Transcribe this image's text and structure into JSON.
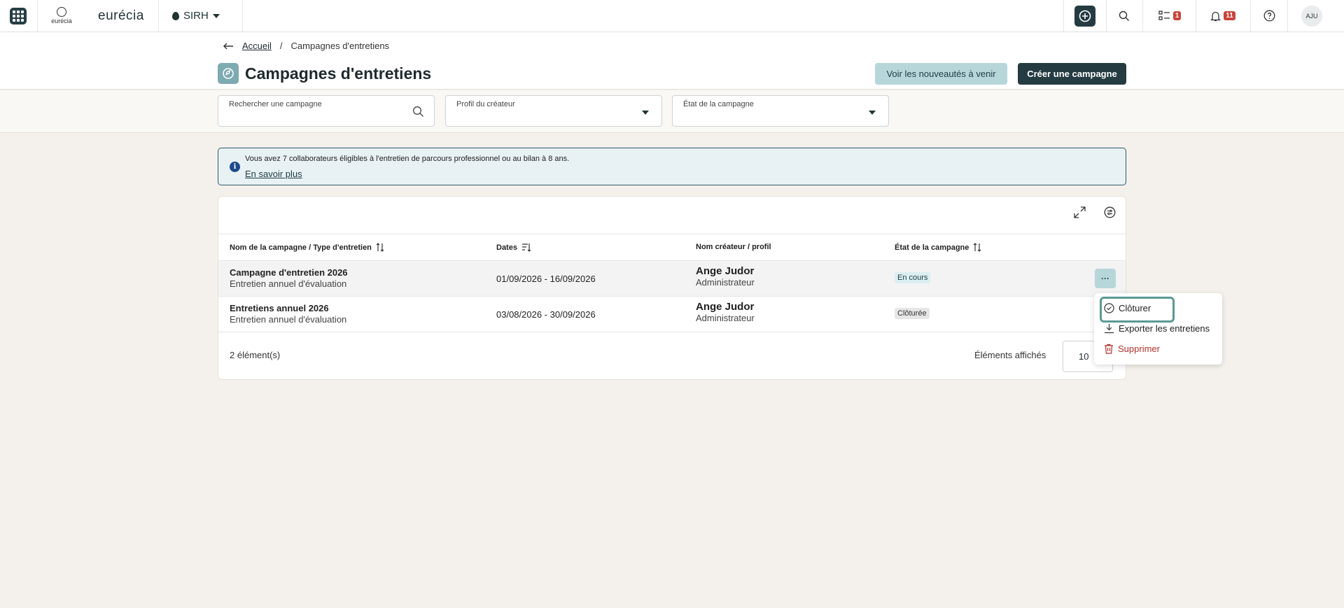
{
  "topbar": {
    "logo_caption": "eurécia",
    "brand": "eurécia",
    "module": "SIRH",
    "tasks_badge": "1",
    "notifications_badge": "11",
    "avatar_initials": "AJU"
  },
  "breadcrumb": {
    "home": "Accueil",
    "separator": "/",
    "current": "Campagnes d'entretiens"
  },
  "header": {
    "title": "Campagnes d'entretiens",
    "btn_news": "Voir les nouveautés à venir",
    "btn_create": "Créer une campagne"
  },
  "filters": {
    "search_label": "Rechercher une campagne",
    "profile_label": "Profil du créateur",
    "state_label": "État de la campagne"
  },
  "info": {
    "text": "Vous avez 7 collaborateurs éligibles à l'entretien de parcours professionnel ou au bilan à 8 ans.",
    "link": "En savoir plus"
  },
  "table": {
    "columns": {
      "name": "Nom de la campagne / Type d'entretien",
      "dates": "Dates",
      "creator": "Nom créateur / profil",
      "state": "État de la campagne"
    },
    "rows": [
      {
        "name": "Campagne d'entretien 2026",
        "type": "Entretien annuel d'évaluation",
        "dates": "01/09/2026 - 16/09/2026",
        "creator": "Ange Judor",
        "profile": "Administrateur",
        "state": "En cours",
        "more": "···"
      },
      {
        "name": "Entretiens annuel 2026",
        "type": "Entretien annuel d'évaluation",
        "dates": "03/08/2026 - 30/09/2026",
        "creator": "Ange Judor",
        "profile": "Administrateur",
        "state": "Clôturée"
      }
    ],
    "count": "2 élément(s)",
    "per_page_label": "Éléments affichés",
    "per_page_value": "10"
  },
  "menu": {
    "close": "Clôturer",
    "export": "Exporter les entretiens",
    "delete": "Supprimer"
  },
  "colors": {
    "primary": "#243b42",
    "secondary": "#b6d6da",
    "danger": "#b3302a",
    "badge": "#c9443b",
    "focus": "#5b9a93"
  }
}
